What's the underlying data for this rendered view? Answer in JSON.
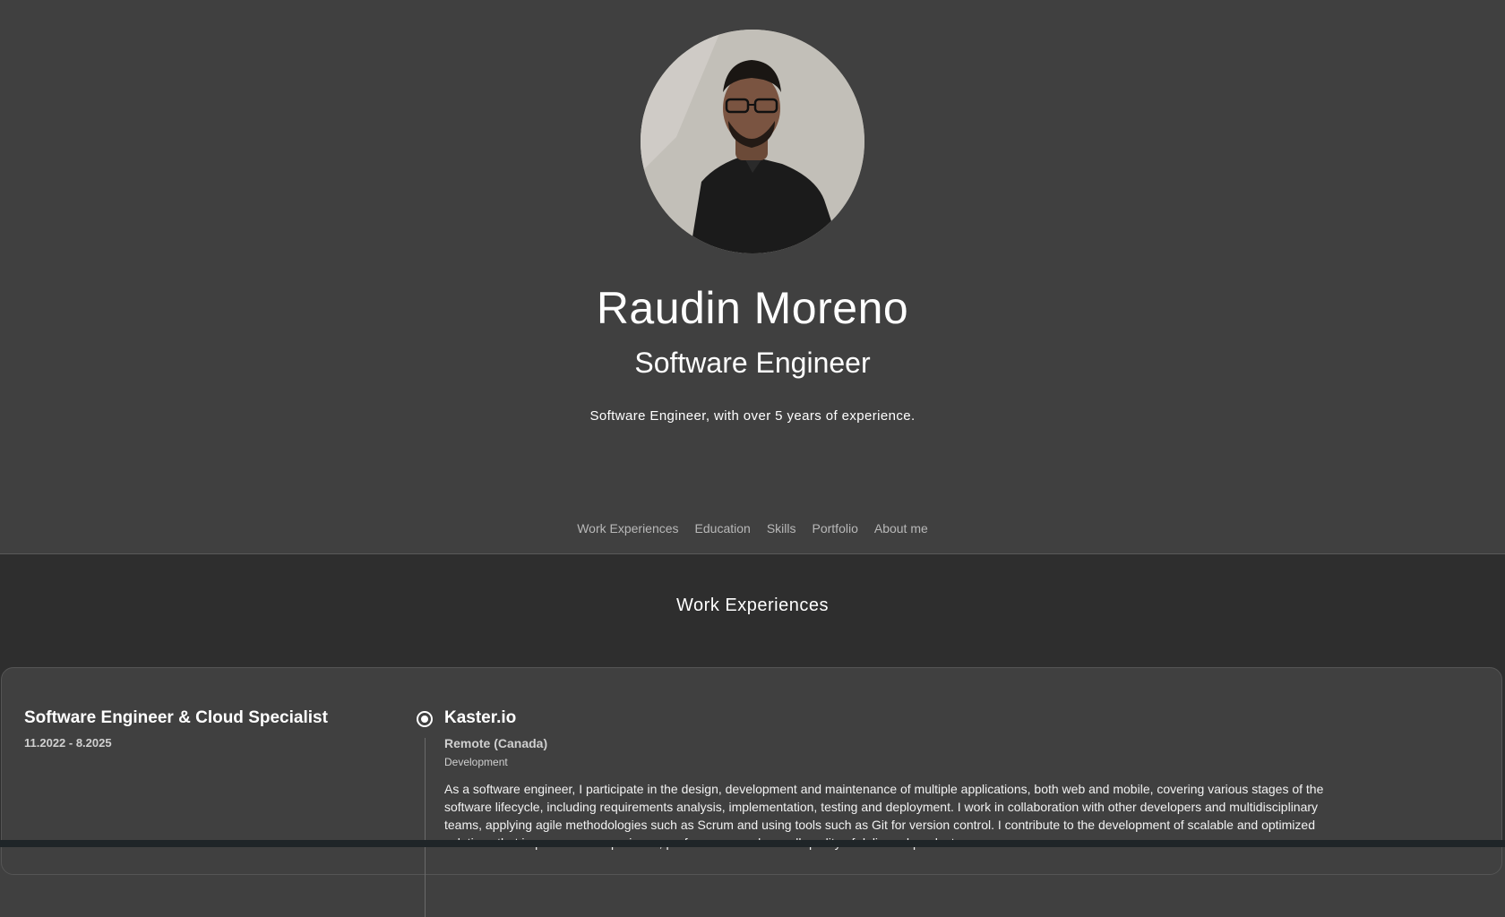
{
  "profile": {
    "name": "Raudin Moreno",
    "title": "Software Engineer",
    "tagline": "Software Engineer, with over 5 years of experience."
  },
  "nav": {
    "items": [
      "Work Experiences",
      "Education",
      "Skills",
      "Portfolio",
      "About me"
    ]
  },
  "work": {
    "section_title": "Work Experiences",
    "entries": [
      {
        "role": "Software Engineer & Cloud Specialist",
        "dates": "11.2022 - 8.2025",
        "company": "Kaster.io",
        "location": "Remote (Canada)",
        "category": "Development",
        "description": "As a software engineer, I participate in the design, development and maintenance of multiple applications, both web and mobile, covering various stages of the software lifecycle, including requirements analysis, implementation, testing and deployment. I work in collaboration with other developers and multidisciplinary teams, applying agile methodologies such as Scrum and using tools such as Git for version control. I contribute to the development of scalable and optimized solutions that improve user experience, performance and overall quality of delivered products."
      }
    ]
  },
  "colors": {
    "hero_background": "#404040",
    "section_background": "#2e2e2e",
    "nav_text": "#b8b8b8",
    "text": "#ffffff"
  }
}
